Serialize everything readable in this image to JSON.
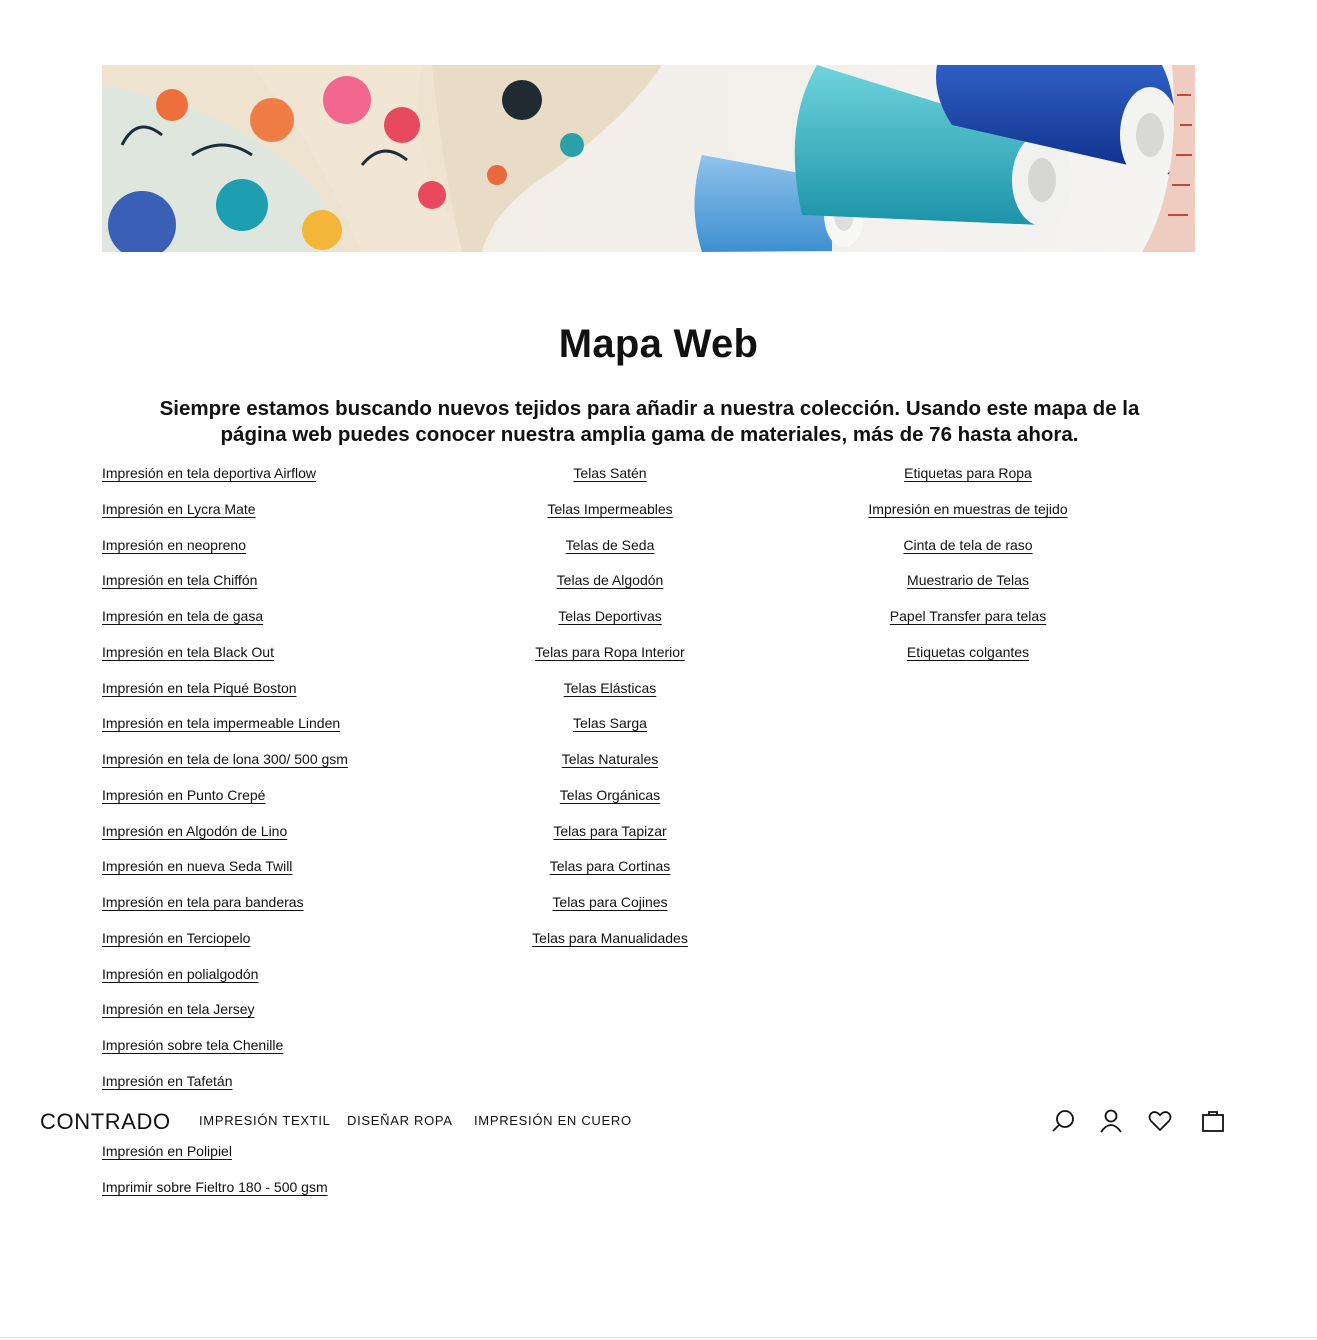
{
  "page": {
    "title": "Mapa Web",
    "intro": "Siempre estamos buscando nuevos tejidos para añadir a nuestra colección. Usando este mapa de la página web puedes conocer nuestra amplia gama de materiales, más de 76 hasta ahora."
  },
  "columns": {
    "printing": [
      "Impresión en tela deportiva Airflow",
      "Impresión en Lycra Mate",
      "Impresión en neopreno",
      "Impresión en tela Chiffón",
      "Impresión en tela de gasa",
      "Impresión en tela Black Out",
      "Impresión en tela Piqué Boston",
      "Impresión en tela impermeable Linden",
      "Impresión en tela de lona 300/ 500 gsm",
      "Impresión en Punto Crepé",
      "Impresión en Algodón de Lino",
      "Impresión en nueva Seda Twill",
      "Impresión en tela para banderas",
      "Impresión en Terciopelo",
      "Impresión en polialgodón",
      "Impresión en tela Jersey",
      "Impresión sobre tela Chenille",
      "Impresión en Tafetán"
    ],
    "printing_below_nav": [
      "Impresión en Polipiel",
      "Imprimir sobre Fieltro 180 - 500 gsm"
    ],
    "fabrics": [
      "Telas Satén",
      "Telas Impermeables",
      "Telas de Seda",
      "Telas de Algodón",
      "Telas Deportivas",
      "Telas para Ropa Interior",
      "Telas Elásticas",
      "Telas Sarga",
      "Telas Naturales",
      "Telas Orgánicas",
      "Telas para Tapizar",
      "Telas para Cortinas",
      "Telas para Cojines",
      "Telas para Manualidades"
    ],
    "accessories": [
      "Etiquetas para Ropa",
      "Impresión en muestras de tejido",
      "Cinta de tela de raso",
      "Muestrario de Telas",
      "Papel Transfer para telas",
      "Etiquetas colgantes"
    ]
  },
  "nav": {
    "logo": "CONTRADO",
    "links": [
      "IMPRESIÓN TEXTIL",
      "DISEÑAR ROPA",
      "IMPRESIÓN EN CUERO"
    ],
    "icons": [
      "search-icon",
      "account-icon",
      "wishlist-heart-icon",
      "shopping-bag-icon"
    ]
  },
  "colors": {
    "text": "#111111",
    "background": "#ffffff"
  }
}
